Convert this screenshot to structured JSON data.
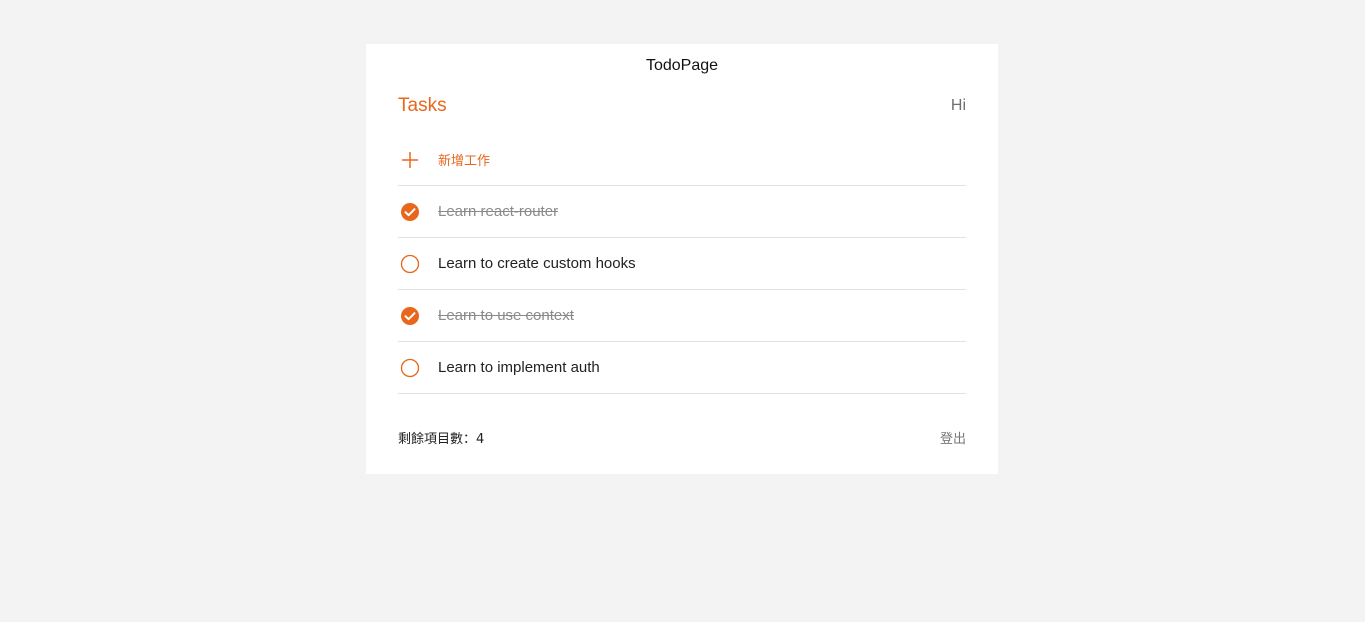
{
  "page": {
    "title": "TodoPage"
  },
  "header": {
    "title": "Tasks",
    "greeting": "Hi"
  },
  "add_task": {
    "label": "新增工作",
    "icon": "plus-icon"
  },
  "todos": [
    {
      "title": "Learn react-router",
      "done": true
    },
    {
      "title": "Learn to create custom hooks",
      "done": false
    },
    {
      "title": "Learn to use context",
      "done": true
    },
    {
      "title": "Learn to implement auth",
      "done": false
    }
  ],
  "footer": {
    "remaining_label": "剩餘項目數：",
    "remaining_count": "4",
    "logout_label": "登出"
  },
  "colors": {
    "accent": "#e8671c",
    "background": "#f3f3f3",
    "card": "#ffffff"
  }
}
